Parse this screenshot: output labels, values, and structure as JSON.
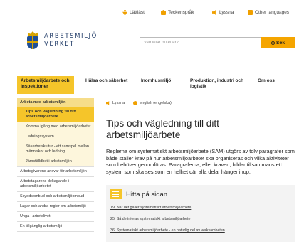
{
  "topbar": {
    "links": [
      {
        "label": "Lättläst",
        "icon": "easy-read-icon"
      },
      {
        "label": "Teckenspråk",
        "icon": "sign-language-icon"
      },
      {
        "label": "Lyssna",
        "icon": "speaker-icon"
      },
      {
        "label": "Other languages",
        "icon": "globe-icon"
      }
    ]
  },
  "logo": {
    "line1": "ARBETSMILJÖ",
    "line2": "VERKET"
  },
  "search": {
    "placeholder": "Vad letar du efter?",
    "button_label": "Sök"
  },
  "nav": {
    "items": [
      {
        "label": "Arbetsmiljöarbete och inspektioner"
      },
      {
        "label": "Hälsa och säkerhet"
      },
      {
        "label": "Inomhusmiljö"
      },
      {
        "label": "Produktion, industri och logistik"
      },
      {
        "label": "Om oss"
      }
    ]
  },
  "sidebar": {
    "header": "Arbeta med arbetsmiljön",
    "selected": "Tips och vägledning till ditt arbetsmiljöarbete",
    "subitems": [
      "Komma igång med arbetsmiljöarbetet",
      "Ledningssystem",
      "Säkerhetskultur - ett samspel mellan människor och ledning",
      "Jämställdhet i arbetsmiljön"
    ],
    "items": [
      "Arbetsgivarens ansvar för arbetsmiljön",
      "Arbetstagarens deltagande i arbetsmiljöarbetet",
      "Skyddsombud och arbetsmiljöombud",
      "Lagar och andra regler om arbetsmiljö",
      "Unga i arbetslivet",
      "En tillgänglig arbetsmiljö"
    ]
  },
  "main": {
    "lang_links": [
      {
        "label": "Lyssna",
        "icon": "speaker-icon"
      },
      {
        "label": "english (engelska)",
        "icon": "globe-icon"
      }
    ],
    "title": "Tips och vägledning till ditt arbetsmiljöarbete",
    "lead": "Reglerna om systematiskt arbetsmiljöarbete (SAM) utgörs av tolv paragrafer som både ställer krav på hur arbetsmiljöarbetet ska organiseras och vilka aktiviteter som behöver genomföras. Paragraferna, eller kraven, bildar tillsammans ett system som ska ses som en helhet där alla delar hänger ihop.",
    "panel": {
      "title": "Hitta på sidan",
      "links": [
        "19. När det gäller systematiskt arbetsmiljöarbete",
        "25. Så definieras systematiskt arbetsmiljöarbete",
        "36. Systematiskt arbetsmiljöarbete - en naturlig del av verksamheten"
      ]
    }
  },
  "colors": {
    "accent": "#f5c52a",
    "brand_blue": "#1f4f97",
    "search_button": "#f5a500"
  }
}
